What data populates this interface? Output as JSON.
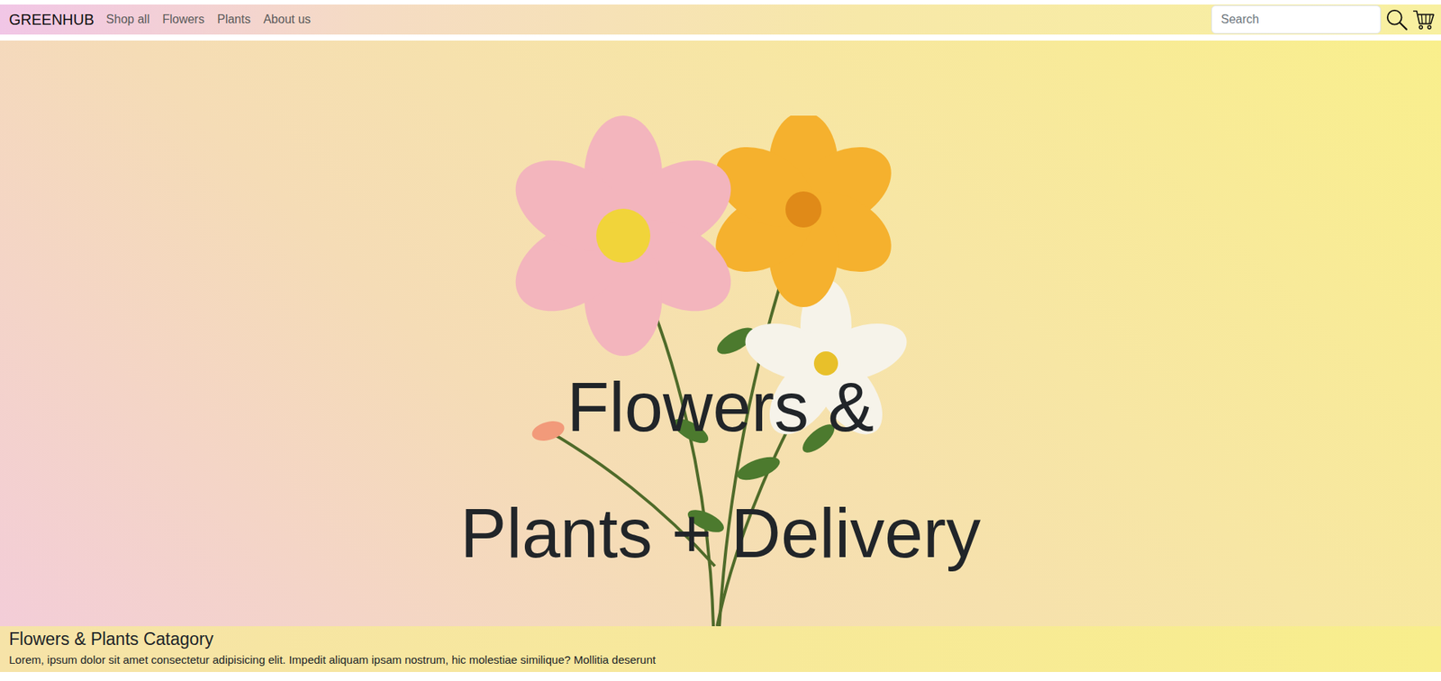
{
  "navbar": {
    "brand": "GREENHUB",
    "links": [
      {
        "label": "Shop all"
      },
      {
        "label": "Flowers"
      },
      {
        "label": "Plants"
      },
      {
        "label": "About us"
      }
    ],
    "search": {
      "placeholder": "Search"
    }
  },
  "hero": {
    "lines": [
      "Flowers &",
      "Plants + Delivery"
    ]
  },
  "category": {
    "title": "Flowers & Plants Catagory",
    "text": "Lorem, ipsum dolor sit amet consectetur adipisicing elit. Impedit aliquam ipsam nostrum, hic molestiae similique? Mollitia deserunt"
  }
}
